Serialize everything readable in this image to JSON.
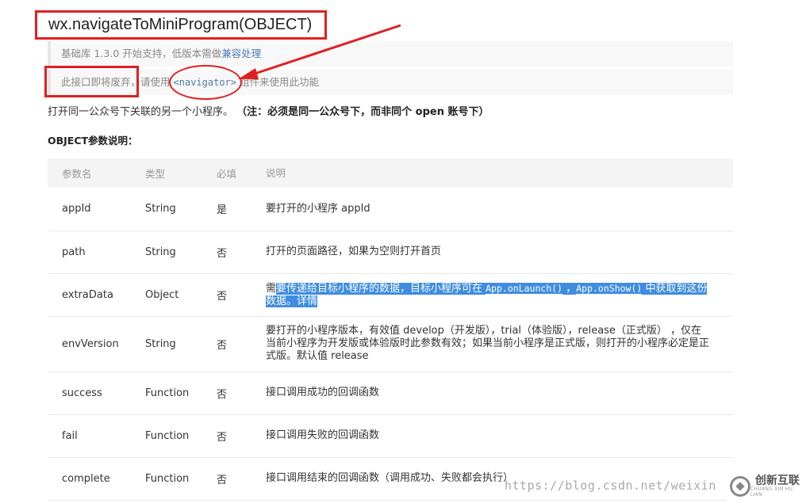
{
  "title": "wx.navigateToMiniProgram(OBJECT)",
  "notes": {
    "version_prefix": "基础库 1.3.0 开始支持，低版本需做",
    "version_link": "兼容处理",
    "deprecated_text": "此接口即将废弃，",
    "use_prefix": "请使用",
    "navigator_code": "<navigator>",
    "use_suffix": "组件来使用此功能"
  },
  "description": {
    "main": "打开同一公众号下关联的另一个小程序。",
    "bold": "（注：必须是同一公众号下，而非同个 open 账号下）"
  },
  "object_heading": "OBJECT参数说明：",
  "table": {
    "headers": [
      "参数名",
      "类型",
      "必填",
      "说明"
    ],
    "rows": [
      {
        "name": "appId",
        "type": "String",
        "required": "是",
        "desc": "要打开的小程序 appId"
      },
      {
        "name": "path",
        "type": "String",
        "required": "否",
        "desc": "打开的页面路径，如果为空则打开首页"
      },
      {
        "name": "extraData",
        "type": "Object",
        "required": "否",
        "desc_parts": {
          "p1": "需",
          "p2": "要传递给目标小程序的数据，目标小程序可在 ",
          "code1": "App.onLaunch()",
          "p3": " ，",
          "code2": "App.onShow()",
          "p4": " 中获取到这份",
          "p5": "数据。详情"
        }
      },
      {
        "name": "envVersion",
        "type": "String",
        "required": "否",
        "desc": "要打开的小程序版本，有效值 develop（开发版），trial（体验版），release（正式版） ，仅在当前小程序为开发版或体验版时此参数有效；如果当前小程序是正式版，则打开的小程序必定是正式版。默认值 release"
      },
      {
        "name": "success",
        "type": "Function",
        "required": "否",
        "desc": "接口调用成功的回调函数"
      },
      {
        "name": "fail",
        "type": "Function",
        "required": "否",
        "desc": "接口调用失败的回调函数"
      },
      {
        "name": "complete",
        "type": "Function",
        "required": "否",
        "desc": "接口调用结束的回调函数（调用成功、失败都会执行）"
      }
    ]
  },
  "watermark": "https://blog.csdn.net/weixin",
  "logo": {
    "text": "创新互联",
    "sub": "CHUANG XIN HU LIAN"
  },
  "colors": {
    "annotation": "#e02020",
    "highlight": "#3f8de0",
    "link": "#4b7db4"
  },
  "icons": [
    "annotation-arrow-icon",
    "logo-icon"
  ]
}
